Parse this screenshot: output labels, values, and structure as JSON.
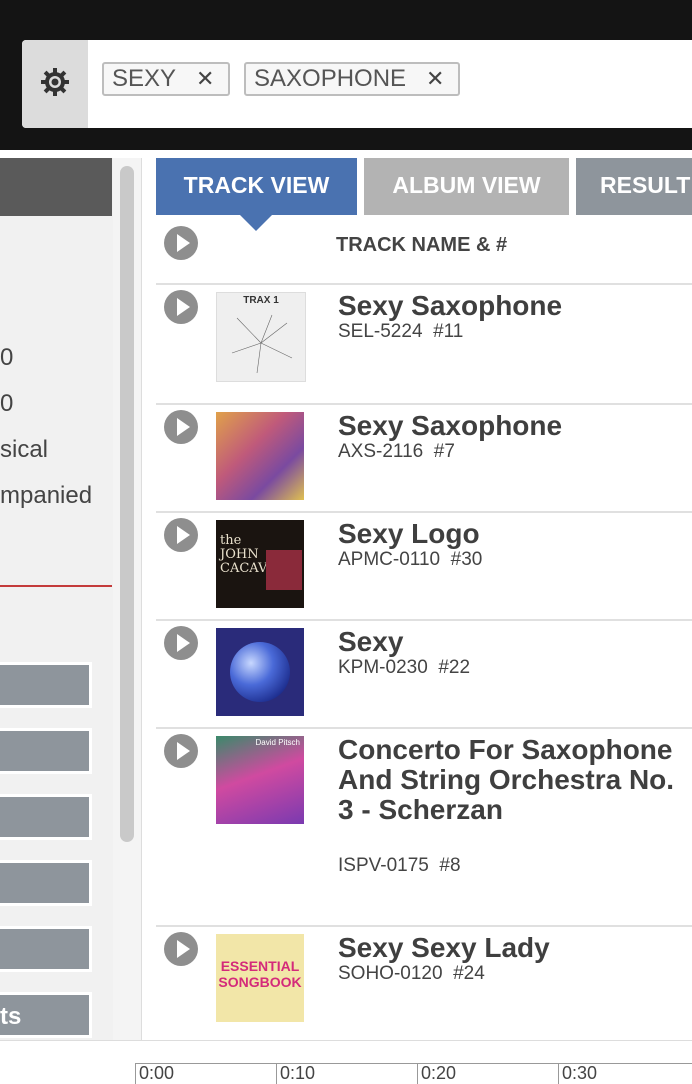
{
  "search": {
    "settings_icon": "gear-icon",
    "tags": [
      {
        "label": "SEXY",
        "remove": "✕"
      },
      {
        "label": "SAXOPHONE",
        "remove": "✕"
      }
    ]
  },
  "sidebar": {
    "texts": [
      "0",
      "0",
      "sical",
      "mpanied"
    ],
    "bottom_button_label": "ts"
  },
  "tabs": {
    "track_view": "TRACK VIEW",
    "album_view": "ALBUM VIEW",
    "results": "RESULT"
  },
  "list": {
    "header": "TRACK NAME & #",
    "tracks": [
      {
        "title": "Sexy Saxophone",
        "code": "SEL-5224",
        "number": "#11"
      },
      {
        "title": "Sexy Saxophone",
        "code": "AXS-2116",
        "number": "#7"
      },
      {
        "title": "Sexy Logo",
        "code": "APMC-0110",
        "number": "#30"
      },
      {
        "title": "Sexy",
        "code": "KPM-0230",
        "number": "#22"
      },
      {
        "title": "Concerto For Saxophone And String Orchestra No. 3 - Scherzan",
        "code": "ISPV-0175",
        "number": "#8"
      },
      {
        "title": "Sexy Sexy Lady",
        "code": "SOHO-0120",
        "number": "#24"
      }
    ],
    "covers": [
      {
        "text": "TRAX 1",
        "bg": "#efefef",
        "fg": "#333333"
      },
      {
        "text": "",
        "bg": "#c05a7a",
        "fg": "#ffffff"
      },
      {
        "text": "the JOHN CACAVAS",
        "bg": "#1a1410",
        "fg": "#e8e0cc"
      },
      {
        "text": "",
        "bg": "#2a2b7a",
        "fg": "#ffffff"
      },
      {
        "text": "David Pitsch",
        "bg": "#3a8a6a",
        "fg": "#ffffff"
      },
      {
        "text": "ESSENTIAL SONGBOOK",
        "bg": "#e8d88a",
        "fg": "#d42a7a"
      }
    ]
  },
  "timeline": {
    "labels": [
      "0:00",
      "0:10",
      "0:20",
      "0:30"
    ]
  },
  "colors": {
    "active_tab": "#4a72b0",
    "inactive_tab": "#b3b3b3",
    "top_bar": "#141414",
    "accent_rule": "#c43b3b"
  }
}
